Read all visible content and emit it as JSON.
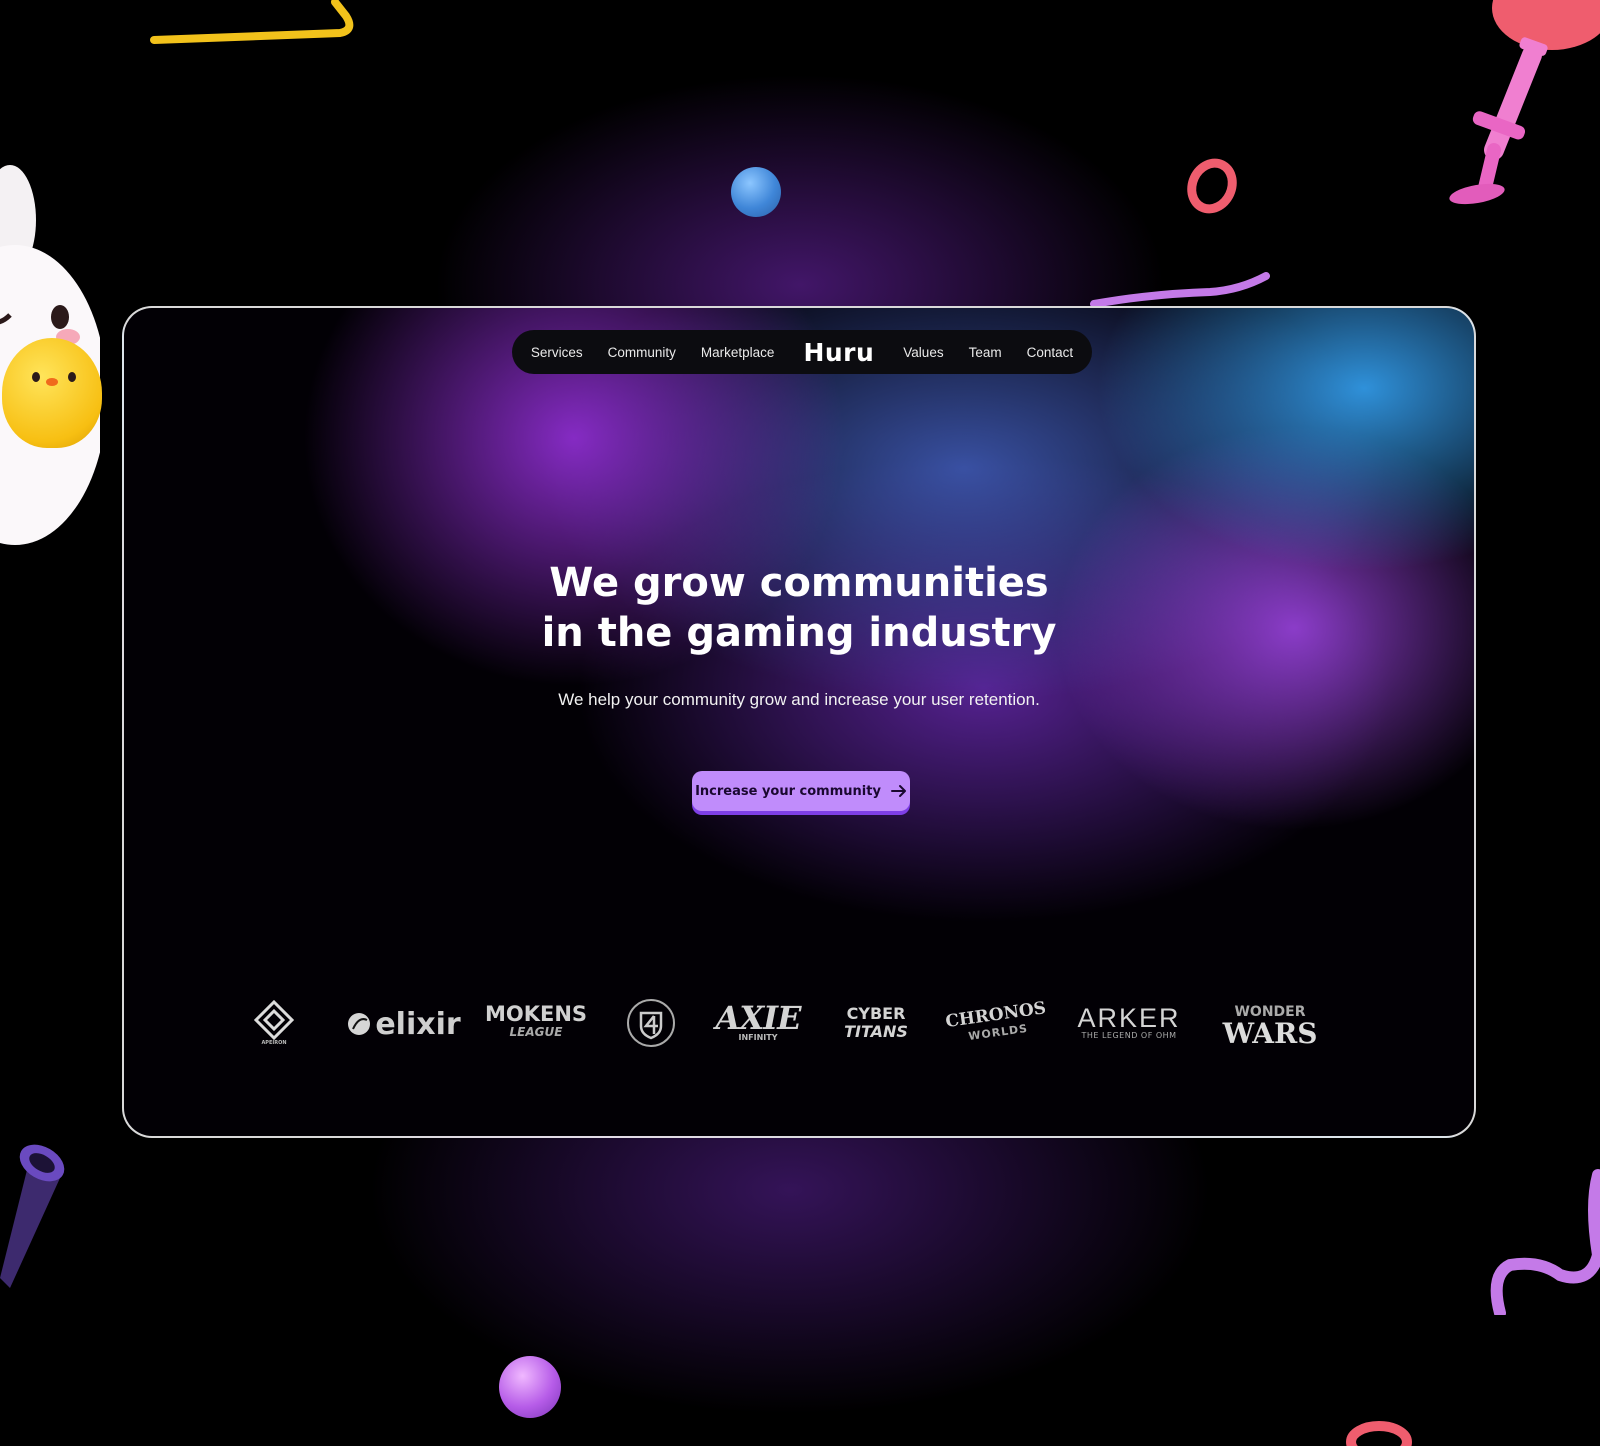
{
  "nav": {
    "items": [
      "Services",
      "Community",
      "Marketplace"
    ],
    "logo": "Huru",
    "items_right": [
      "Values",
      "Team",
      "Contact"
    ]
  },
  "hero": {
    "title_line1": "We grow communities",
    "title_line2": "in the gaming industry",
    "subtitle": "We help your community grow and increase your user retention.",
    "cta_label": "Increase your community"
  },
  "partners": {
    "apeiron": "APEIRON",
    "elixir": "elixir",
    "mokens_1": "MOKENS",
    "mokens_2": "LEAGUE",
    "axie_1": "AXIE",
    "axie_2": "INFINITY",
    "cyber_1": "CYBER",
    "cyber_2": "TITANS",
    "chronos_1": "CHRONOS",
    "chronos_2": "WORLDS",
    "arker_1": "ARKER",
    "arker_2": "THE LEGEND OF OHM",
    "wonder_1": "WONDER",
    "wonder_2": "WARS"
  },
  "colors": {
    "background": "#000000",
    "cta_bg": "#c08cfb",
    "cta_shadow": "#7e3fe6",
    "accent_blue": "#3f86d8",
    "accent_purple": "#b65ce8"
  }
}
